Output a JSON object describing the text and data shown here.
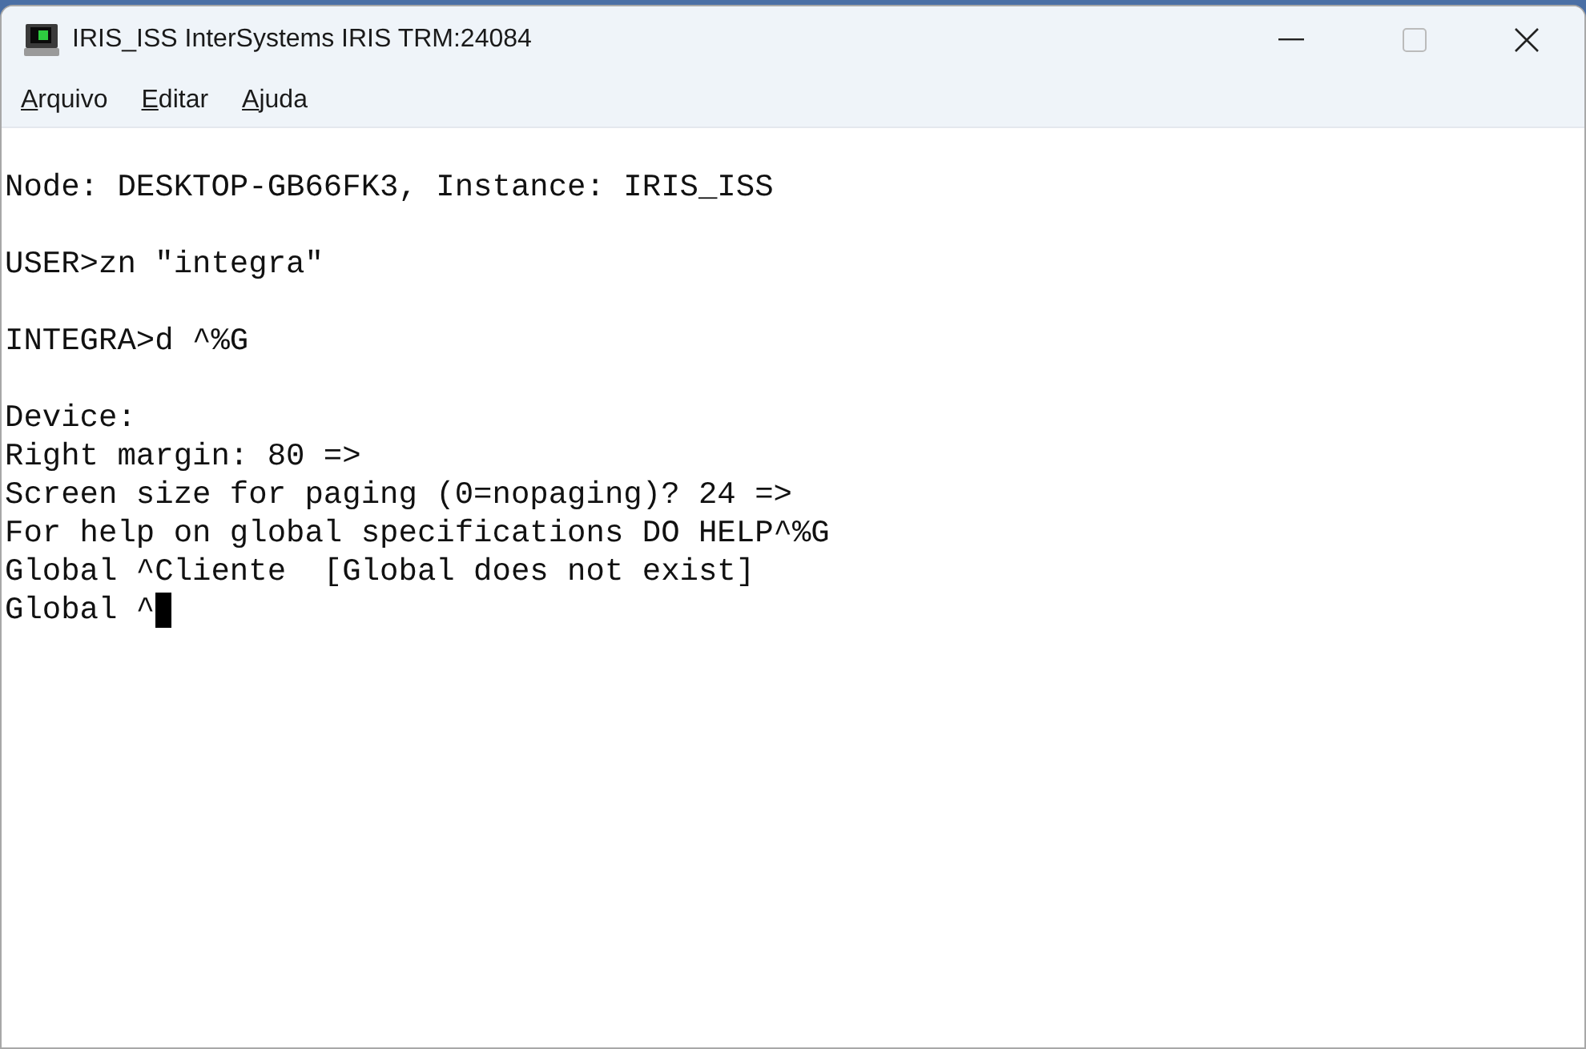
{
  "window": {
    "title": "IRIS_ISS InterSystems IRIS TRM:24084"
  },
  "menu": [
    "Arquivo",
    "Editar",
    "Ajuda"
  ],
  "terminal": {
    "cursor": true,
    "blocks": [
      {
        "lines": [
          "Node: DESKTOP-GB66FK3, Instance: IRIS_ISS"
        ]
      },
      {
        "lines": [
          "USER>zn \"integra\""
        ]
      },
      {
        "lines": [
          "INTEGRA>d ^%G"
        ]
      },
      {
        "lines": [
          "Device:",
          "Right margin: 80 =>",
          "Screen size for paging (0=nopaging)? 24 =>",
          "For help on global specifications DO HELP^%G",
          "Global ^Cliente  [Global does not exist]",
          "Global ^"
        ]
      }
    ]
  }
}
